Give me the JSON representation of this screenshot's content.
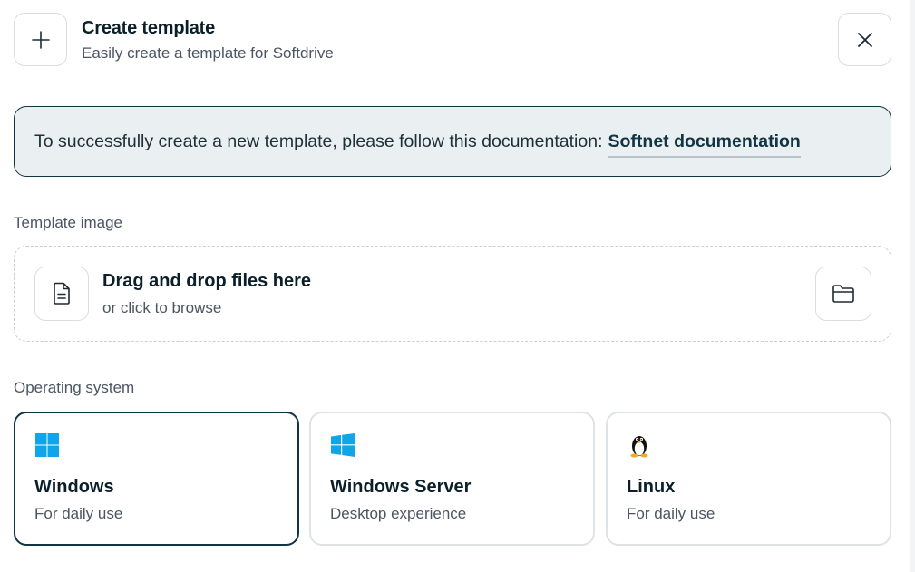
{
  "header": {
    "title": "Create template",
    "subtitle": "Easily create a template for Softdrive",
    "add_icon": "plus-icon",
    "close_icon": "close-icon"
  },
  "banner": {
    "text": "To successfully create a new template, please follow this documentation:",
    "link_label": "Softnet documentation"
  },
  "template_image": {
    "label": "Template image",
    "dropzone_title": "Drag and drop files here",
    "dropzone_subtitle": "or click to browse",
    "file_icon": "file-icon",
    "browse_icon": "folder-icon"
  },
  "operating_system": {
    "label": "Operating system",
    "selected": "Windows",
    "options": [
      {
        "name": "Windows",
        "description": "For daily use",
        "icon": "windows-icon"
      },
      {
        "name": "Windows Server",
        "description": "Desktop experience",
        "icon": "windows-server-icon"
      },
      {
        "name": "Linux",
        "description": "For daily use",
        "icon": "linux-icon"
      }
    ]
  },
  "colors": {
    "primary": "#123543",
    "banner_bg": "#eaeff2",
    "windows_blue": "#0ea5e9",
    "muted_text": "#4b5563",
    "border": "#dfe3e6"
  }
}
